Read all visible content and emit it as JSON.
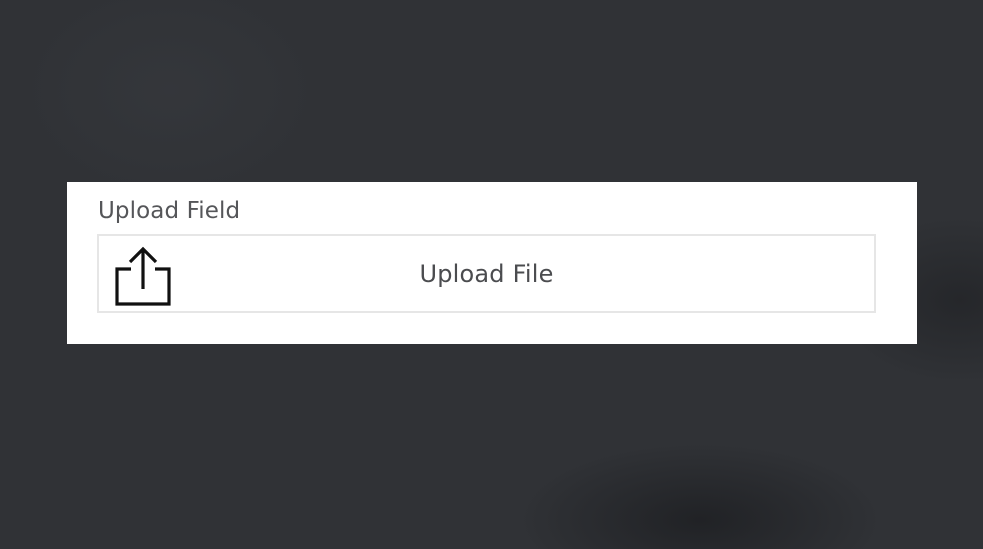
{
  "upload_field": {
    "label": "Upload Field",
    "button_text": "Upload File",
    "icon": "upload-share-icon"
  },
  "colors": {
    "background": "#303236",
    "panel": "#ffffff",
    "label_text": "#555659",
    "border": "#e6e6e6"
  }
}
